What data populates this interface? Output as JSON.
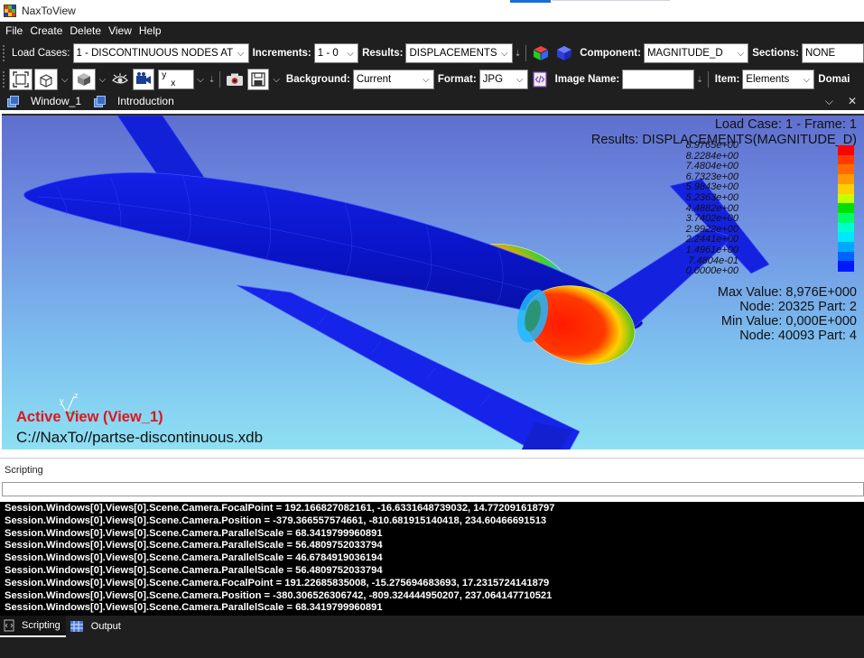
{
  "window": {
    "title": "NaxToView"
  },
  "menu": [
    "File",
    "Create",
    "Delete",
    "View",
    "Help"
  ],
  "toolbar1": {
    "load_cases_label": "Load Cases:",
    "load_cases_value": "1 - DISCONTINUOUS NODES AT",
    "increments_label": "Increments:",
    "increments_value": "1 - 0",
    "results_label": "Results:",
    "results_value": "DISPLACEMENTS",
    "component_label": "Component:",
    "component_value": "MAGNITUDE_D",
    "sections_label": "Sections:",
    "sections_value": "NONE"
  },
  "toolbar2": {
    "axis_combo_top": "y",
    "axis_combo_bottom": "x",
    "background_label": "Background:",
    "background_value": "Current",
    "format_label": "Format:",
    "format_value": "JPG",
    "image_name_label": "Image Name:",
    "image_name_value": "",
    "item_label": "Item:",
    "item_value": "Elements",
    "domain_label": "Domai"
  },
  "window_tabs": [
    "Window_1",
    "Introduction"
  ],
  "viewport": {
    "load_case_text": "Load Case: 1 - Frame: 1",
    "results_text": "Results: DISPLACEMENTS(MAGNITUDE_D)",
    "legend_labels": [
      "8.9765e+00",
      "8.2284e+00",
      "7.4804e+00",
      "6.7323e+00",
      "5.9843e+00",
      "5.2363e+00",
      "4.4882e+00",
      "3.7402e+00",
      "2.9922e+00",
      "2.2441e+00",
      "1.4961e+00",
      "7.4804e-01",
      "0.0000e+00"
    ],
    "legend_colors": [
      "#ff0000",
      "#ff3a00",
      "#ff6a00",
      "#ff9a00",
      "#ffd000",
      "#c8ff00",
      "#00e000",
      "#00ff66",
      "#00ffcc",
      "#00e8ff",
      "#00a8ff",
      "#0064ff",
      "#0018ff"
    ],
    "max_value_text": "Max Value: 8,976E+000",
    "max_node_text": "Node: 20325 Part: 2",
    "min_value_text": "Min Value: 0,000E+000",
    "min_node_text": "Node: 40093 Part: 4",
    "axis_z": "z",
    "axis_y": "y",
    "active_view_text": "Active View (View_1)",
    "file_path": "C://NaxTo//partse-discontinuous.xdb"
  },
  "scripting": {
    "header": "Scripting",
    "input_value": "",
    "lines": [
      "Session.Windows[0].Views[0].Scene.Camera.FocalPoint = 192.166827082161, -16.6331648739032, 14.772091618797",
      "Session.Windows[0].Views[0].Scene.Camera.Position = -379.366557574661, -810.681915140418, 234.60466691513",
      "Session.Windows[0].Views[0].Scene.Camera.ParallelScale = 68.3419799960891",
      "Session.Windows[0].Views[0].Scene.Camera.ParallelScale = 56.4809752033794",
      "Session.Windows[0].Views[0].Scene.Camera.ParallelScale = 46.6784919036194",
      "Session.Windows[0].Views[0].Scene.Camera.ParallelScale = 56.4809752033794",
      "Session.Windows[0].Views[0].Scene.Camera.FocalPoint = 191.22685835008, -15.275694683693, 17.2315724141879",
      "Session.Windows[0].Views[0].Scene.Camera.Position = -380.306526306742, -809.324444950207, 237.064147710521",
      "Session.Windows[0].Views[0].Scene.Camera.ParallelScale = 68.3419799960891"
    ]
  },
  "bottom_tabs": [
    "Scripting",
    "Output"
  ]
}
